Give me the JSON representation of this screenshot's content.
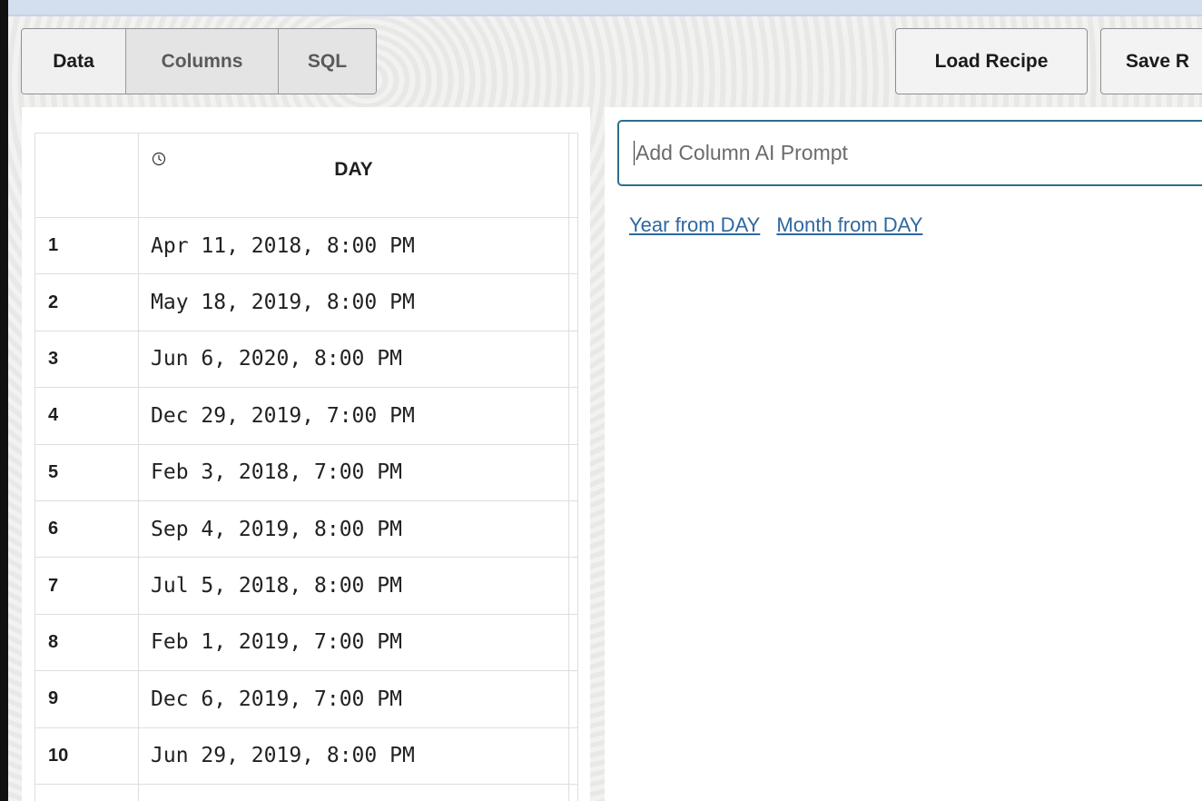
{
  "toolbar": {
    "tabs": [
      {
        "label": "Data",
        "active": true
      },
      {
        "label": "Columns",
        "active": false
      },
      {
        "label": "SQL",
        "active": false
      }
    ],
    "load_label": "Load Recipe",
    "save_label": "Save R"
  },
  "table": {
    "column": {
      "name": "DAY",
      "type_icon": "clock-icon"
    },
    "rows": [
      {
        "index": "1",
        "day": "Apr 11, 2018, 8:00 PM"
      },
      {
        "index": "2",
        "day": "May 18, 2019, 8:00 PM"
      },
      {
        "index": "3",
        "day": "Jun 6, 2020, 8:00 PM"
      },
      {
        "index": "4",
        "day": "Dec 29, 2019, 7:00 PM"
      },
      {
        "index": "5",
        "day": "Feb 3, 2018, 7:00 PM"
      },
      {
        "index": "6",
        "day": "Sep 4, 2019, 8:00 PM"
      },
      {
        "index": "7",
        "day": "Jul 5, 2018, 8:00 PM"
      },
      {
        "index": "8",
        "day": "Feb 1, 2019, 7:00 PM"
      },
      {
        "index": "9",
        "day": "Dec 6, 2019, 7:00 PM"
      },
      {
        "index": "10",
        "day": "Jun 29, 2019, 8:00 PM"
      },
      {
        "index": "",
        "day": ""
      }
    ]
  },
  "prompt": {
    "placeholder": "Add Column AI Prompt",
    "value": ""
  },
  "suggestions": [
    "Year from DAY",
    "Month from DAY"
  ],
  "colors": {
    "accent_border": "#2d6e8c",
    "link": "#2f679f",
    "top_accent": "#d3deee"
  }
}
